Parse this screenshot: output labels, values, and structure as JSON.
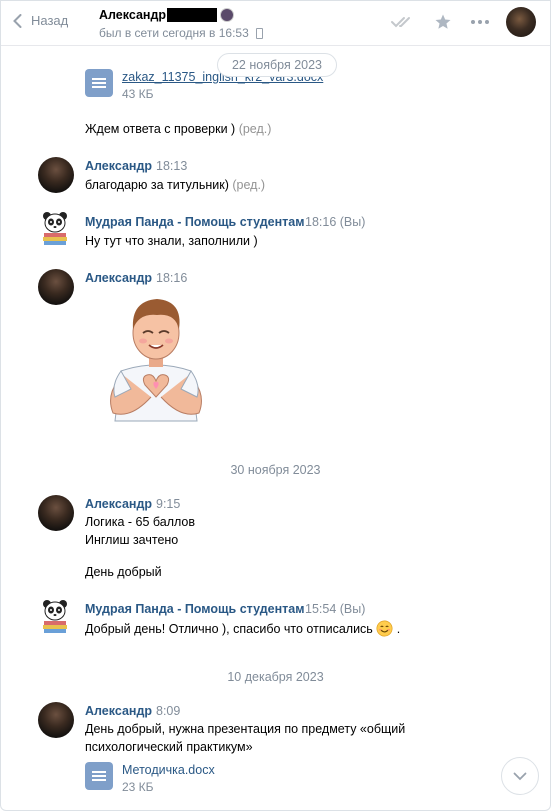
{
  "header": {
    "back_label": "Назад",
    "name": "Александр",
    "status": "был в сети сегодня в 16:53"
  },
  "dates": [
    "22 ноября 2023",
    "30 ноября 2023",
    "10 декабря 2023"
  ],
  "messages": [
    {
      "file_name": "zakaz_11375_inglish_kr2_var3.docx",
      "file_size": "43 КБ"
    },
    {
      "text": "Ждем ответа с проверки )",
      "edited": "(ред.)"
    },
    {
      "author": "Александр",
      "time": "18:13",
      "text": "благодарю за титульник)",
      "edited": "(ред.)"
    },
    {
      "author": "Мудрая Панда - Помощь студентам",
      "time": "18:16 (Вы)",
      "text": "Ну тут что знали, заполнили )"
    },
    {
      "author": "Александр",
      "time": "18:16",
      "sticker": "heart-hands-sticker"
    },
    {
      "author": "Александр",
      "time": "9:15",
      "lines": [
        "Логика - 65 баллов",
        "Инглиш зачтено"
      ],
      "text2": "День добрый"
    },
    {
      "author": "Мудрая Панда - Помощь студентам",
      "time": "15:54 (Вы)",
      "text": "Добрый день! Отлично ), спасибо что отписались"
    },
    {
      "author": "Александр",
      "time": "8:09",
      "lines": [
        "День добрый, нужна презентация по предмету «общий",
        "психологический практикум»"
      ],
      "file_name": "Методичка.docx",
      "file_size": "23 КБ"
    }
  ]
}
